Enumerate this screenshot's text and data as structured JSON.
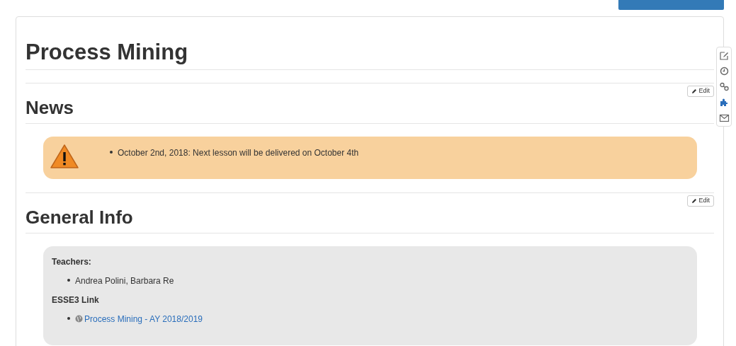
{
  "title": "Process Mining",
  "sections": [
    {
      "heading": "News",
      "edit_button": "Edit",
      "box": {
        "kind": "warning",
        "items": [
          "October 2nd, 2018: Next lesson will be delivered on October 4th"
        ]
      }
    },
    {
      "heading": "General Info",
      "edit_button": "Edit",
      "box": {
        "kind": "info",
        "groups": [
          {
            "label": "Teachers:",
            "items": [
              {
                "text": "Andrea Polini, Barbara Re",
                "kind": "text"
              }
            ]
          },
          {
            "label": "ESSE3 Link",
            "items": [
              {
                "text": "Process Mining - AY 2018/2019",
                "kind": "link"
              }
            ]
          }
        ]
      }
    }
  ],
  "side_toolbar": [
    {
      "kind": "edit",
      "active": false
    },
    {
      "kind": "history",
      "active": false
    },
    {
      "kind": "links",
      "active": false
    },
    {
      "kind": "plugin",
      "active": true
    },
    {
      "kind": "mail",
      "active": false
    }
  ]
}
